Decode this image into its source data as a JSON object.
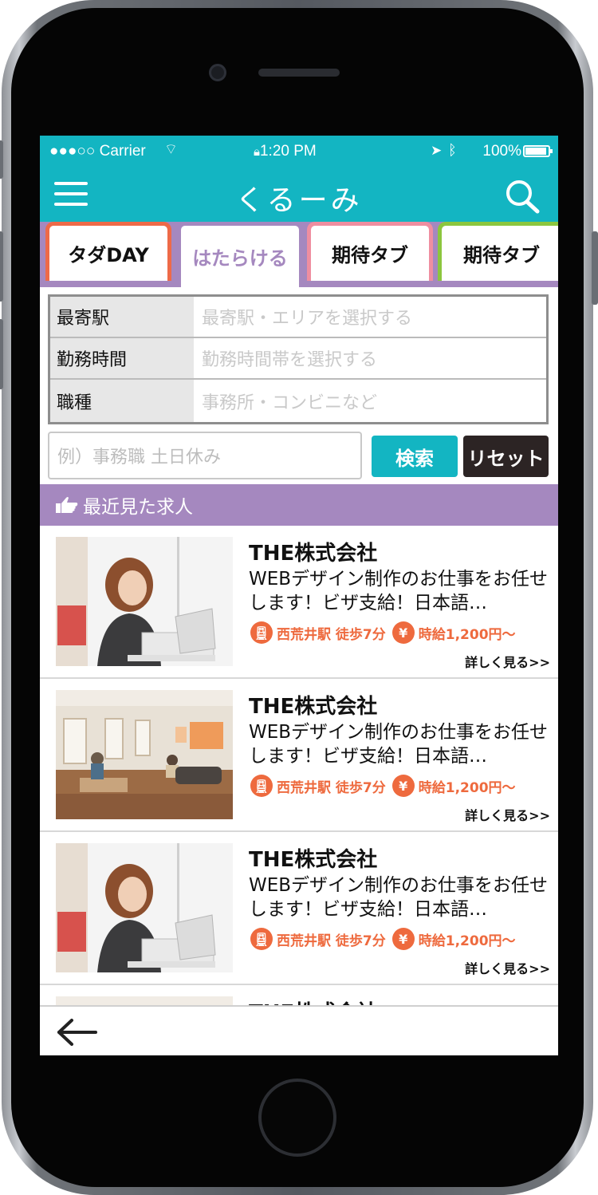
{
  "status_bar": {
    "carrier": "●●●○○ Carrier",
    "time": "1:20 PM",
    "battery": "100%"
  },
  "header": {
    "title": "くるーみ"
  },
  "tabs": [
    {
      "label": "タダDAY",
      "border_color": "#ee6a48"
    },
    {
      "label": "はたらける",
      "border_color": "#a588bf",
      "active": true
    },
    {
      "label": "期待タブ",
      "border_color": "#ef8ea0"
    },
    {
      "label": "期待タブ",
      "border_color": "#8cc63e"
    }
  ],
  "filters": [
    {
      "label": "最寄駅",
      "placeholder": "最寄駅・エリアを選択する"
    },
    {
      "label": "勤務時間",
      "placeholder": "勤務時間帯を選択する"
    },
    {
      "label": "職種",
      "placeholder": "事務所・コンビニなど"
    }
  ],
  "search": {
    "placeholder": "例）事務職 土日休み",
    "search_label": "検索",
    "reset_label": "リセット"
  },
  "recent": {
    "title": "最近見た求人"
  },
  "jobs": [
    {
      "company": "THE株式会社",
      "description": "WEBデザイン制作のお仕事をお任せします！ビザ支給！日本語…",
      "station": "西荒井駅 徒歩7分",
      "wage": "時給1,200円〜",
      "more": "詳しく見る>>",
      "image": "woman-laptop"
    },
    {
      "company": "THE株式会社",
      "description": "WEBデザイン制作のお仕事をお任せします！ビザ支給！日本語…",
      "station": "西荒井駅 徒歩7分",
      "wage": "時給1,200円〜",
      "more": "詳しく見る>>",
      "image": "office-lounge"
    },
    {
      "company": "THE株式会社",
      "description": "WEBデザイン制作のお仕事をお任せします！ビザ支給！日本語…",
      "station": "西荒井駅 徒歩7分",
      "wage": "時給1,200円〜",
      "more": "詳しく見る>>",
      "image": "woman-laptop"
    },
    {
      "company": "THE株式会社",
      "description": "",
      "station": "",
      "wage": "",
      "more": "",
      "image": "office-lounge"
    }
  ],
  "icons": {
    "menu": "hamburger-icon",
    "search": "search-icon",
    "recent": "pointing-hand-icon",
    "station": "train-icon",
    "wage": "yen-icon",
    "back": "back-arrow-icon"
  },
  "colors": {
    "primary": "#13b5c2",
    "accent": "#a588bf",
    "orange": "#ee6a3e",
    "dark": "#2c2424"
  }
}
